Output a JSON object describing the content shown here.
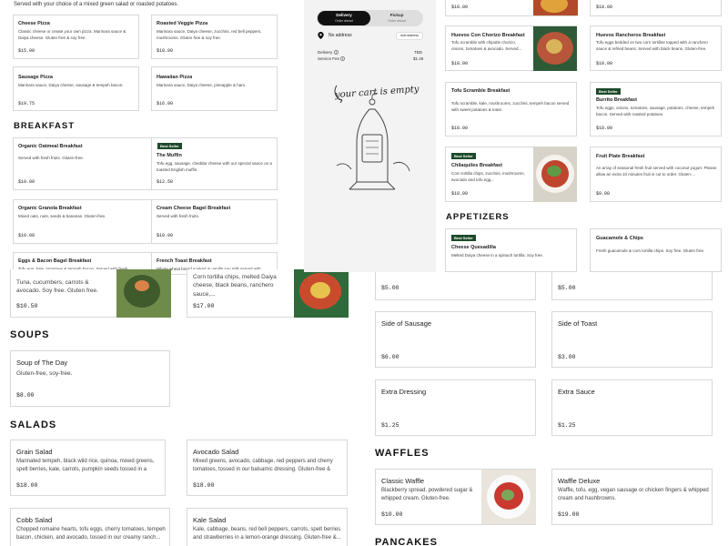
{
  "intro_text": "Served with your choice of a mixed green salad or roasted potatoes.",
  "pizza": [
    {
      "title": "Cheese Pizza",
      "desc": "Classic cheese or create your own pizza. Marinara sauce & Daiya cheese. Gluten free & soy free.",
      "price": "$15.00"
    },
    {
      "title": "Roasted Veggie Pizza",
      "desc": "Marinara sauce, Daiya cheese, zucchini, red bell peppers, mushrooms. Gluten free & soy free.",
      "price": "$18.00"
    },
    {
      "title": "Sausage Pizza",
      "desc": "Marinara sauce, Daiya cheese, sausage & tempeh bacon.",
      "price": "$19.75"
    },
    {
      "title": "Hawaiian Pizza",
      "desc": "Marinara sauce, Daiya cheese, pineapple & ham.",
      "price": "$16.00"
    }
  ],
  "breakfast_left": {
    "heading": "BREAKFAST",
    "items": [
      {
        "title": "Organic Oatmeal Breakfast",
        "desc": "Served with fresh fruits. Gluten-free.",
        "price": "$10.00"
      },
      {
        "title": "The Muffin",
        "desc": "Tofu egg, sausage, cheddar cheese with our special sauce on a toasted English muffin.",
        "price": "$12.50",
        "badge": "Best Seller"
      },
      {
        "title": "Organic Granola Breakfast",
        "desc": "Mixed oats, nuts, seeds & bananas. Gluten-free.",
        "price": "$10.00"
      },
      {
        "title": "Cream Cheese Bagel Breakfast",
        "desc": "Served with fresh fruits.",
        "price": "$10.00"
      },
      {
        "title": "Eggs & Bacon Bagel Breakfast",
        "desc": "Tofu egg, kale, tomatoes & tempeh bacon. Served with fresh",
        "price": ""
      },
      {
        "title": "French Toast Breakfast",
        "desc": "Whole wheat bread soaked in vanilla soy milk served with",
        "price": ""
      }
    ]
  },
  "lower_left": {
    "poke": {
      "desc": "Tuna, cucumbers, carrots & avocado. Soy free. Gluten free.",
      "price": "$10.50"
    },
    "nachos": {
      "desc": "Corn tortilla chips, melted Daiya cheese, black beans, ranchero sauce,...",
      "price": "$17.00"
    },
    "soups_heading": "SOUPS",
    "soup": {
      "title": "Soup of The Day",
      "desc": "Gluten-free, soy-free.",
      "price": "$8.00"
    },
    "salads_heading": "SALADS",
    "salads": [
      {
        "title": "Grain Salad",
        "desc": "Marinated tempeh, black wild rice, quinoa, mixed greens, spelt berries, kale, carrots, pumpkin seeds tossed in a balsamic...",
        "price": "$18.00"
      },
      {
        "title": "Avocado Salad",
        "desc": "Mixed greens, avocado, cabbage, red peppers and cherry tomatoes, tossed in our balsamic dressing. Gluten-free & soy...",
        "price": "$18.00"
      },
      {
        "title": "Cobb Salad",
        "desc": "Chopped romaine hearts, tofu eggs, cherry tomatoes, tempeh bacon, chicken, and avocado, tossed in our creamy ranch...",
        "price": ""
      },
      {
        "title": "Kale Salad",
        "desc": "Kale, cabbage, beans, red bell peppers, carrots, spelt berries and strawberries in a lemon-orange dressing. Gluten-free &...",
        "price": ""
      }
    ]
  },
  "cart": {
    "delivery_label": "Delivery",
    "delivery_sub": "Order ahead",
    "pickup_label": "Pickup",
    "pickup_sub": "Order ahead",
    "no_address": "No address",
    "add_address": "Add address",
    "delivery_row_label": "Delivery",
    "delivery_row_value": "TBD",
    "service_fee_label": "Service Fee",
    "service_fee_value": "$1.49",
    "empty_text": "your cart is empty"
  },
  "right_top": [
    {
      "price": "$18.00"
    },
    {
      "price": "$18.00"
    }
  ],
  "right_breakfast": [
    {
      "title": "Huevos Con Chorizo Breakfast",
      "desc": "Tofu scramble with chipotle chorizo, onions, tomatoes & avocado. Served...",
      "price": "$18.00"
    },
    {
      "title": "Huevos Rancheros Breakfast",
      "desc": "Tofu eggs bedded on two corn tortillas topped with a ranchero sauce & refried beans. Served with black beans. Gluten-free.",
      "price": "$18.00"
    },
    {
      "title": "Tofu Scramble Breakfast",
      "desc": "Tofu scramble, kale, mushrooms, zucchini, tempeh bacon served with sweet potatoes & toast.",
      "price": "$18.00"
    },
    {
      "title": "Burrito Breakfast",
      "desc": "Tofu eggs, onions, tomatoes, sausage, potatoes, cheese, tempeh bacon. Served with roasted potatoes.",
      "price": "$18.00",
      "badge": "Best Seller"
    },
    {
      "title": "Chilaquiles Breakfast",
      "desc": "Corn tortilla chips, zucchini, mushrooms, avocado and tofu egg...",
      "price": "$18.00",
      "badge": "Best Seller"
    },
    {
      "title": "Fruit Plate Breakfast",
      "desc": "An array of seasonal fresh fruit served with coconut yogurt. Please allow an extra 10 minutes fruit is cut to order. Gluten-...",
      "price": "$9.00"
    }
  ],
  "appetizers": {
    "heading": "APPETIZERS",
    "items": [
      {
        "title": "Cheese Quesadilla",
        "desc": "Melted Daiya cheese in a spinach tortilla. Soy free.",
        "badge": "Best Seller"
      },
      {
        "title": "Guacamole & Chips",
        "desc": "Fresh guacamole & corn tortilla chips. Soy free. Gluten free."
      }
    ]
  },
  "sides": [
    {
      "title": "",
      "price": "$5.00"
    },
    {
      "title": "",
      "price": "$5.00"
    },
    {
      "title": "Side of Sausage",
      "price": "$6.00"
    },
    {
      "title": "Side of Toast",
      "price": "$3.00"
    },
    {
      "title": "Extra Dressing",
      "price": "$1.25"
    },
    {
      "title": "Extra Sauce",
      "price": "$1.25"
    }
  ],
  "waffles": {
    "heading": "WAFFLES",
    "items": [
      {
        "title": "Classic Waffle",
        "desc": "Blackberry spread, powdered sugar & whipped cream. Gluten-free.",
        "price": "$10.00"
      },
      {
        "title": "Waffle Deluxe",
        "desc": "Waffle, tofu, egg, vegan sausage or chicken fingers & whipped cream and hashbrowns.",
        "price": "$19.00"
      }
    ]
  },
  "pancakes_heading": "PANCAKES"
}
